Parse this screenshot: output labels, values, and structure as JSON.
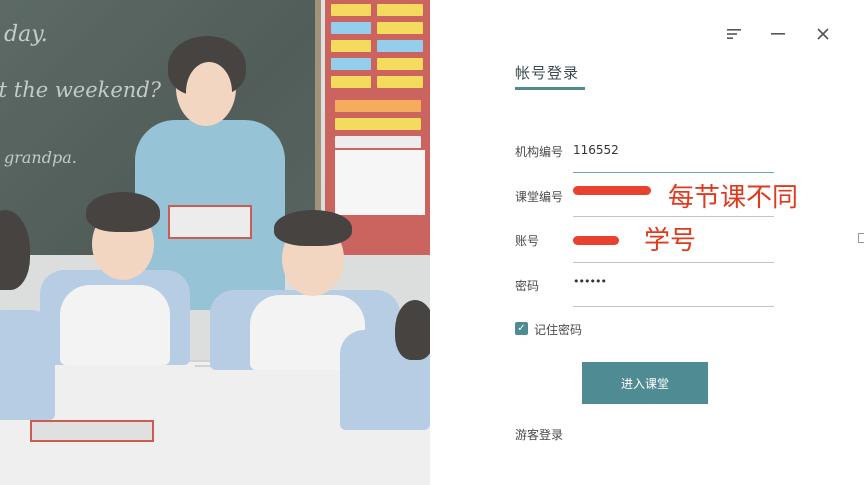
{
  "photo": {
    "chalk_lines": [
      "day.",
      "ot the weekend?",
      "grandpa."
    ]
  },
  "window": {
    "menu_icon": "menu-lines-icon",
    "minimize_icon": "minimize-icon",
    "close_icon": "close-icon"
  },
  "login": {
    "tab_title": "帐号登录",
    "fields": [
      {
        "label": "机构编号",
        "value": "116552"
      },
      {
        "label": "课堂编号",
        "value": ""
      },
      {
        "label": "账号",
        "value": ""
      },
      {
        "label": "密码",
        "value": "••••••"
      }
    ],
    "remember_label": "记住密码",
    "remember_checked": true,
    "submit_label": "进入课堂",
    "guest_label": "游客登录"
  },
  "annotations": {
    "classroom_note": "每节课不同",
    "account_note": "学号"
  },
  "colors": {
    "accent": "#4f8b93",
    "annotation_red": "#e03a1e",
    "redaction_red": "#e8412e"
  }
}
